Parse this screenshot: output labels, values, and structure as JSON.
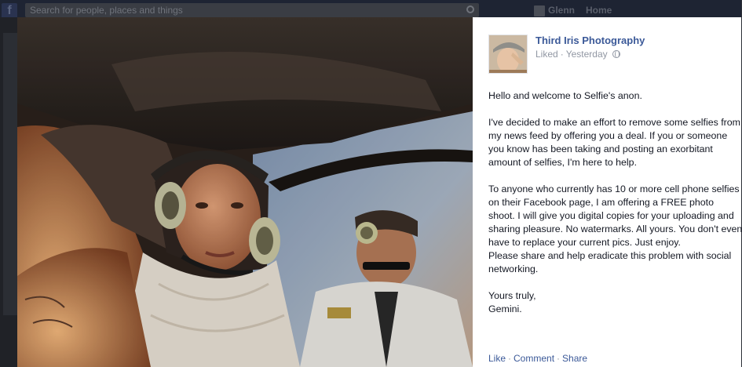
{
  "topbar": {
    "search_placeholder": "Search for people, places and things",
    "nav": [
      "Glenn",
      "Home"
    ]
  },
  "post": {
    "page_name": "Third Iris Photography",
    "liked_label": "Liked",
    "time": "Yesterday",
    "privacy_icon": "globe-icon",
    "paragraphs": [
      "Hello and welcome to Selfie's anon.",
      "I've decided to make an effort to remove some selfies from my news feed by offering you a deal. If you or someone you know has been taking and posting an exorbitant amount of selfies, I'm here to help.",
      "To anyone who currently has 10 or more cell phone selfies on their Facebook page, I am offering a FREE photo shoot. I will give you digital copies for your uploading and sharing pleasure. No watermarks. All yours. You don't even have to replace your current pics. Just enjoy.\nPlease share and help eradicate this problem with social networking.",
      "Yours truly,\nGemini."
    ],
    "actions": {
      "like": "Like",
      "comment": "Comment",
      "share": "Share"
    }
  },
  "colors": {
    "link": "#3b5998",
    "muted": "#9197a3",
    "text": "#141823"
  }
}
